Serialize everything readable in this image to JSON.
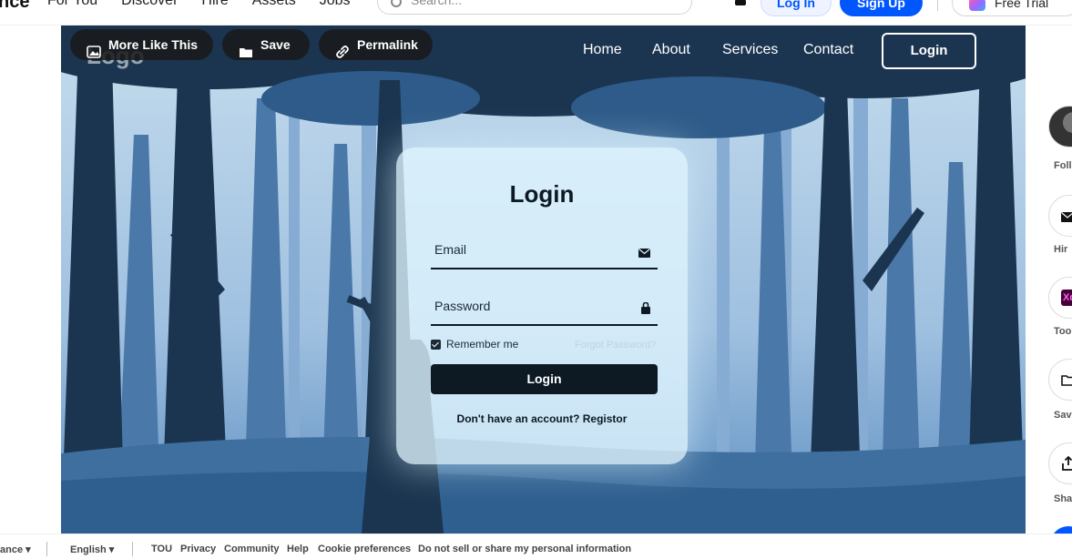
{
  "topnav": {
    "brand": "nce",
    "links": [
      "For You",
      "Discover",
      "Hire",
      "Assets",
      "Jobs"
    ],
    "search_placeholder": "Search...",
    "login_label": "Log In",
    "signup_label": "Sign Up",
    "trial_label": "Free Trial"
  },
  "artwork": {
    "chips": {
      "more_like_this": "More Like This",
      "save": "Save",
      "permalink": "Permalink"
    },
    "site": {
      "logo": "Logo",
      "nav": {
        "home": "Home",
        "about": "About",
        "services": "Services",
        "contact": "Contact",
        "login": "Login"
      },
      "form": {
        "title": "Login",
        "email_label": "Email",
        "password_label": "Password",
        "remember_label": "Remember me",
        "forgot_label": "Forgot Password?",
        "submit_label": "Login",
        "register_text": "Don't have an account? Registor"
      }
    }
  },
  "rail": {
    "follow": "Follo",
    "hire": "Hir",
    "tools": "Too",
    "save": "Sav",
    "share": "Sha",
    "tool_badge": "Xd"
  },
  "footer": {
    "region": "ance",
    "language": "English",
    "links": [
      "TOU",
      "Privacy",
      "Community",
      "Help",
      "Cookie preferences",
      "Do not sell or share my personal information"
    ]
  },
  "colors": {
    "accent": "#0057ff",
    "form_dark": "#0d1a24",
    "sky": "#a9c6e2",
    "tree_dark": "#1b3550"
  }
}
